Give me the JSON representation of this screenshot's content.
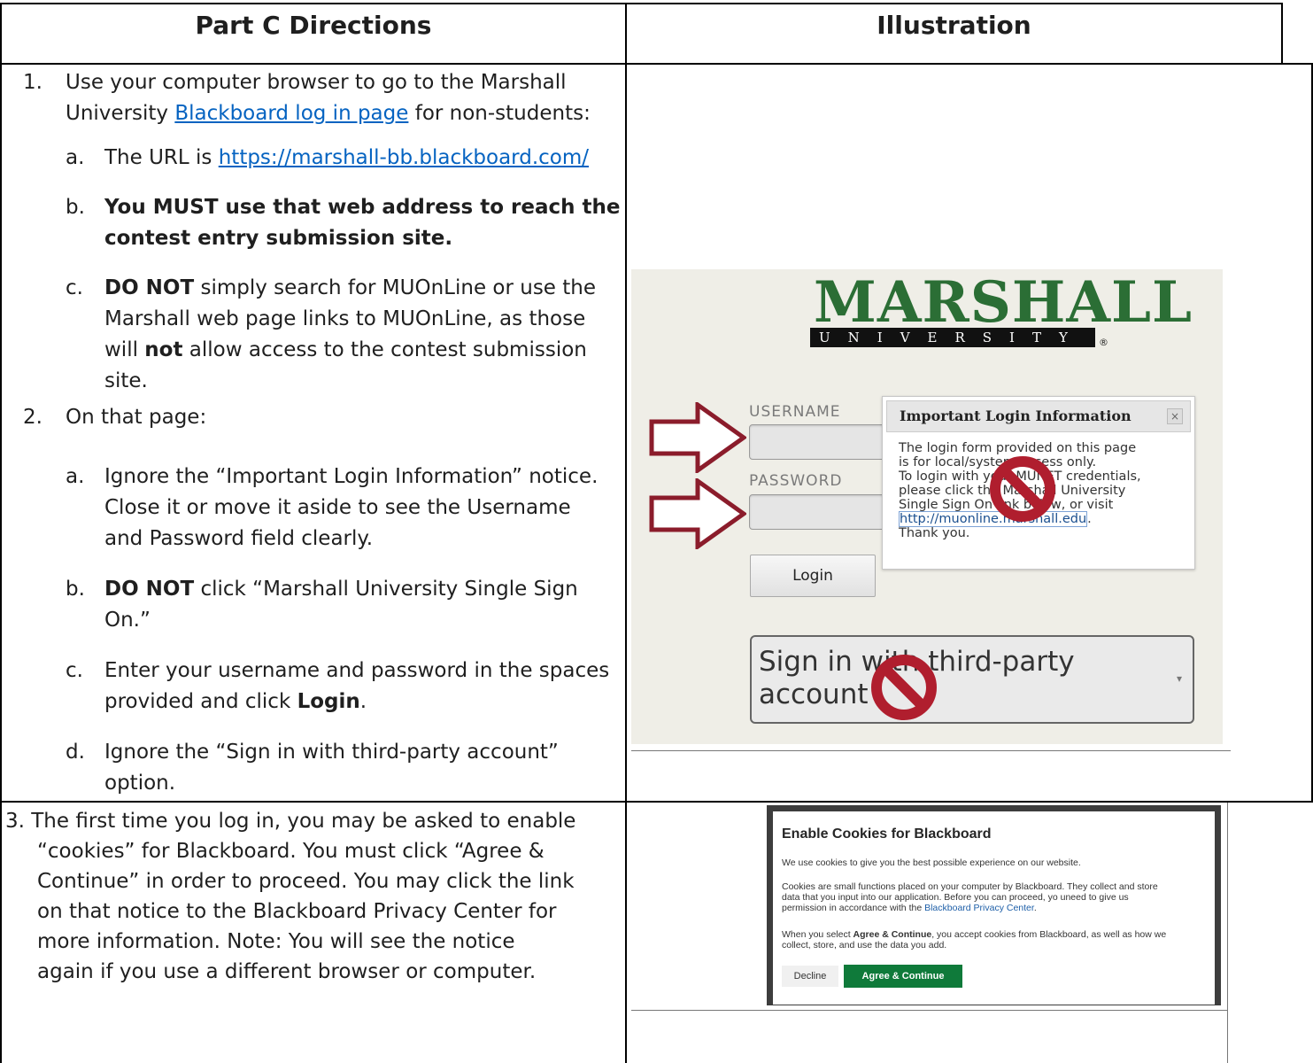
{
  "table": {
    "header_left": "Part C Directions",
    "header_right": "Illustration"
  },
  "step1": {
    "num": "1.",
    "line1": "Use your computer browser to go to the Marshall",
    "line2_pre": "University ",
    "line2_link": "Blackboard log in page",
    "line2_post": " for non-students:",
    "a_label": "a.",
    "a_text": "The URL is ",
    "a_link": "https://marshall-bb.blackboard.com/",
    "b_label": "b.",
    "b_line1": "You MUST use that web address to reach the",
    "b_line2": "contest entry submission site.",
    "c_label": "c.",
    "c_bold": "DO NOT",
    "c_line1": " simply search for MUOnLine or use the",
    "c_line2": "Marshall web page links to MUOnLine, as those",
    "c_line3_pre": "will ",
    "c_line3_bold": "not",
    "c_line3_post": " allow access to the contest submission",
    "c_line4": "site."
  },
  "step2": {
    "num": "2.",
    "text": "On that page:",
    "a_label": "a.",
    "a_line1": "Ignore the “Important Login Information” notice.",
    "a_line2": "Close it or move it aside to see the Username",
    "a_line3": "and Password field clearly.",
    "b_label": "b.",
    "b_bold": "DO NOT",
    "b_line1": " click “Marshall University Single Sign",
    "b_line2": "On.”",
    "c_label": "c.",
    "c_line1": "Enter your username and password in the spaces",
    "c_line2_pre": "provided and click ",
    "c_line2_bold": "Login",
    "c_line2_post": ".",
    "d_label": "d.",
    "d_line1": "Ignore the “Sign in with third-party account”",
    "d_line2": "option."
  },
  "step3": {
    "line1": "3. The first time you log in, you may be asked to enable",
    "line2": "“cookies” for Blackboard. You must click “Agree &",
    "line3": "Continue” in order to proceed. You may click the link",
    "line4": "on that notice to the Blackboard Privacy Center for",
    "line5": "more information. Note: You will see the notice",
    "line6": "again if you use a different browser or computer."
  },
  "login_shot": {
    "logo": "MARSHALL",
    "logo_sub": "UNIVERSITY",
    "logo_reg": "®",
    "username_label": "USERNAME",
    "password_label": "PASSWORD",
    "login_button": "Login",
    "third_party": "Sign in with third-party account",
    "third_party_caret": "▾",
    "popup_title": "Important Login Information",
    "popup_close": "×",
    "popup_line1": "The login form provided on this page",
    "popup_line2": "is for local/system access only.",
    "popup_line3": "To login with your MUNET credentials,",
    "popup_line4": "please click the Marshall University",
    "popup_line5": "Single Sign On link below, or visit",
    "popup_link": "http://muonline.marshall.edu",
    "popup_line6_post": ".",
    "popup_line7": "Thank you.",
    "arrow_color": "#8b1c2b",
    "noentry_color": "#b01e2e"
  },
  "cookie_shot": {
    "title": "Enable Cookies for Blackboard",
    "p1": "We use cookies to give you the best possible experience on our website.",
    "p2_line1": "Cookies are small functions placed on your computer by Blackboard. They collect and store",
    "p2_line2": "data that you input into our application. Before you can proceed, yo uneed to give us",
    "p2_line3_pre": "permission in accordance with the ",
    "p2_link": "Blackboard Privacy Center",
    "p2_line3_post": ".",
    "p3_line1_pre": "When you select ",
    "p3_bold": "Agree & Continue",
    "p3_line1_post": ", you accept cookies from Blackboard, as well as how we",
    "p3_line2": "collect, store, and use the data you add.",
    "decline": "Decline",
    "agree": "Agree & Continue"
  }
}
